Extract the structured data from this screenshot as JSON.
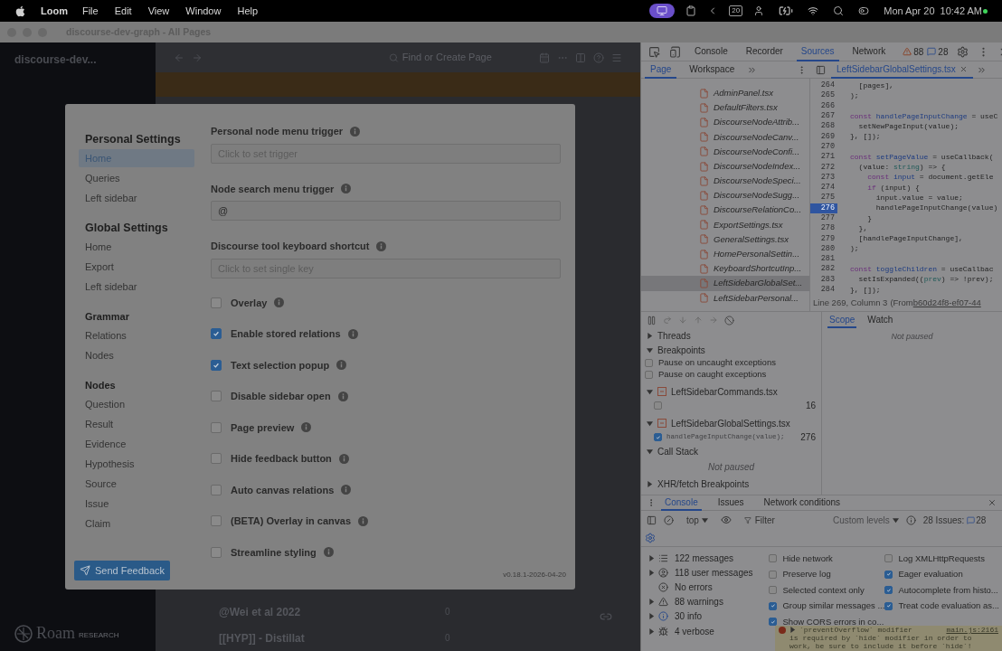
{
  "menubar": {
    "app": "Loom",
    "menus": [
      "File",
      "Edit",
      "View",
      "Window",
      "Help"
    ],
    "calendar_day": "20",
    "date": "Mon Apr 20",
    "time": "10:42 AM"
  },
  "window": {
    "title": "discourse-dev-graph - All Pages"
  },
  "roam": {
    "graph_name": "discourse-dev...",
    "search": {
      "placeholder": "Find or Create Page"
    },
    "rows": [
      {
        "title": "@Wei et al 2022",
        "count": "0"
      },
      {
        "title": "[[HYP]] - Distillat",
        "count": "0"
      }
    ],
    "logo": {
      "word": "Roam",
      "tag": "RESEARCH"
    }
  },
  "settings_dialog": {
    "nav": [
      {
        "heading": "Personal Settings",
        "kind": "major",
        "items": [
          {
            "label": "Home",
            "selected": true
          },
          {
            "label": "Queries",
            "selected": false
          },
          {
            "label": "Left sidebar",
            "selected": false
          }
        ]
      },
      {
        "heading": "Global Settings",
        "kind": "major",
        "items": [
          {
            "label": "Home",
            "selected": false
          },
          {
            "label": "Export",
            "selected": false
          },
          {
            "label": "Left sidebar",
            "selected": false
          }
        ]
      },
      {
        "heading": "Grammar",
        "kind": "minor",
        "items": [
          {
            "label": "Relations",
            "selected": false
          },
          {
            "label": "Nodes",
            "selected": false
          }
        ]
      },
      {
        "heading": "Nodes",
        "kind": "minor",
        "items": [
          {
            "label": "Question",
            "selected": false
          },
          {
            "label": "Result",
            "selected": false
          },
          {
            "label": "Evidence",
            "selected": false
          },
          {
            "label": "Hypothesis",
            "selected": false
          },
          {
            "label": "Source",
            "selected": false
          },
          {
            "label": "Issue",
            "selected": false
          },
          {
            "label": "Claim",
            "selected": false
          }
        ]
      }
    ],
    "fields": [
      {
        "label": "Personal node menu trigger",
        "placeholder": "Click to set trigger"
      },
      {
        "label": "Node search menu trigger",
        "value": "@"
      },
      {
        "label": "Discourse tool keyboard shortcut",
        "placeholder": "Click to set single key"
      }
    ],
    "toggles": [
      {
        "label": "Overlay",
        "checked": false
      },
      {
        "label": "Enable stored relations",
        "checked": true
      },
      {
        "label": "Text selection popup",
        "checked": true
      },
      {
        "label": "Disable sidebar open",
        "checked": false
      },
      {
        "label": "Page preview",
        "checked": false
      },
      {
        "label": "Hide feedback button",
        "checked": false
      },
      {
        "label": "Auto canvas relations",
        "checked": false
      },
      {
        "label": "(BETA) Overlay in canvas",
        "checked": false
      },
      {
        "label": "Streamline styling",
        "checked": false
      }
    ],
    "feedback_button": "Send Feedback",
    "version": "v0.18.1-2026-04-20"
  },
  "devtools": {
    "tabs": [
      {
        "label": "Console",
        "selected": false
      },
      {
        "label": "Recorder",
        "selected": false
      },
      {
        "label": "Sources",
        "selected": true
      },
      {
        "label": "Network",
        "selected": false
      }
    ],
    "warnings": "88",
    "issues": "28",
    "nav_tabs": [
      {
        "label": "Page",
        "selected": true
      },
      {
        "label": "Workspace",
        "selected": false
      }
    ],
    "editor_tab": "LeftSidebarGlobalSettings.tsx",
    "files": [
      {
        "name": "AdminPanel.tsx",
        "selected": false
      },
      {
        "name": "DefaultFilters.tsx",
        "selected": false
      },
      {
        "name": "DiscourseNodeAttrib...",
        "selected": false
      },
      {
        "name": "DiscourseNodeCanv...",
        "selected": false
      },
      {
        "name": "DiscourseNodeConfi...",
        "selected": false
      },
      {
        "name": "DiscourseNodeIndex...",
        "selected": false
      },
      {
        "name": "DiscourseNodeSpeci...",
        "selected": false
      },
      {
        "name": "DiscourseNodeSugg...",
        "selected": false
      },
      {
        "name": "DiscourseRelationCo...",
        "selected": false
      },
      {
        "name": "ExportSettings.tsx",
        "selected": false
      },
      {
        "name": "GeneralSettings.tsx",
        "selected": false
      },
      {
        "name": "HomePersonalSettin...",
        "selected": false
      },
      {
        "name": "KeyboardShortcutInp...",
        "selected": false
      },
      {
        "name": "LeftSidebarGlobalSet...",
        "selected": true
      },
      {
        "name": "LeftSidebarPersonal...",
        "selected": false
      }
    ],
    "code": [
      {
        "number": "264",
        "breakpoint": false,
        "tokens": [
          {
            "kind": "plain",
            "text": "  [pages],"
          }
        ]
      },
      {
        "number": "265",
        "breakpoint": false,
        "tokens": [
          {
            "kind": "plain",
            "text": ");"
          }
        ]
      },
      {
        "number": "266",
        "breakpoint": false
      },
      {
        "number": "267",
        "breakpoint": false,
        "tokens": [
          {
            "kind": "keyword",
            "text": "const "
          },
          {
            "kind": "name",
            "text": "handlePageInputChange"
          },
          {
            "kind": "plain",
            "text": " = useC"
          }
        ]
      },
      {
        "number": "268",
        "breakpoint": false,
        "tokens": [
          {
            "kind": "plain",
            "text": "  setNewPageInput(value);"
          }
        ]
      },
      {
        "number": "269",
        "breakpoint": false,
        "tokens": [
          {
            "kind": "plain",
            "text": "}, []);"
          }
        ]
      },
      {
        "number": "270",
        "breakpoint": false
      },
      {
        "number": "271",
        "breakpoint": false,
        "tokens": [
          {
            "kind": "keyword",
            "text": "const "
          },
          {
            "kind": "name",
            "text": "setPageValue"
          },
          {
            "kind": "plain",
            "text": " = useCallback("
          }
        ]
      },
      {
        "number": "272",
        "breakpoint": false,
        "tokens": [
          {
            "kind": "plain",
            "text": "  (value: "
          },
          {
            "kind": "type",
            "text": "string"
          },
          {
            "kind": "plain",
            "text": ") => {"
          }
        ]
      },
      {
        "number": "273",
        "breakpoint": false,
        "tokens": [
          {
            "kind": "keyword",
            "text": "    const "
          },
          {
            "kind": "name",
            "text": "input"
          },
          {
            "kind": "plain",
            "text": " = document.getEle"
          }
        ]
      },
      {
        "number": "274",
        "breakpoint": false,
        "tokens": [
          {
            "kind": "keyword",
            "text": "    if "
          },
          {
            "kind": "plain",
            "text": "(input) {"
          }
        ]
      },
      {
        "number": "275",
        "breakpoint": false,
        "tokens": [
          {
            "kind": "plain",
            "text": "      input.value = value;"
          }
        ]
      },
      {
        "number": "276",
        "breakpoint": true,
        "tokens": [
          {
            "kind": "plain",
            "text": "      handlePageInputChange(value)"
          }
        ]
      },
      {
        "number": "277",
        "breakpoint": false,
        "tokens": [
          {
            "kind": "plain",
            "text": "    }"
          }
        ]
      },
      {
        "number": "278",
        "breakpoint": false,
        "tokens": [
          {
            "kind": "plain",
            "text": "  },"
          }
        ]
      },
      {
        "number": "279",
        "breakpoint": false,
        "tokens": [
          {
            "kind": "plain",
            "text": "  [handlePageInputChange],"
          }
        ]
      },
      {
        "number": "280",
        "breakpoint": false,
        "tokens": [
          {
            "kind": "plain",
            "text": ");"
          }
        ]
      },
      {
        "number": "281",
        "breakpoint": false
      },
      {
        "number": "282",
        "breakpoint": false,
        "tokens": [
          {
            "kind": "keyword",
            "text": "const "
          },
          {
            "kind": "name",
            "text": "toggleChildren"
          },
          {
            "kind": "plain",
            "text": " = useCallbac"
          }
        ]
      },
      {
        "number": "283",
        "breakpoint": false,
        "tokens": [
          {
            "kind": "plain",
            "text": "  setIsExpanded(("
          },
          {
            "kind": "type",
            "text": "prev"
          },
          {
            "kind": "plain",
            "text": ") => !prev);"
          }
        ]
      },
      {
        "number": "284",
        "breakpoint": false,
        "tokens": [
          {
            "kind": "plain",
            "text": "}, []);"
          }
        ]
      }
    ],
    "status": {
      "position": "Line 269, Column 3",
      "source_prefix": "(From ",
      "source_link": "b60d24f8-ef07-44"
    },
    "sections": [
      {
        "kind": "threads",
        "title": "Threads",
        "expanded": false
      },
      {
        "kind": "breakpoints",
        "title": "Breakpoints",
        "expanded": true
      },
      {
        "kind": "callstack",
        "title": "Call Stack",
        "expanded": true
      },
      {
        "kind": "xhr",
        "title": "XHR/fetch Breakpoints",
        "expanded": false
      }
    ],
    "pause_options": [
      {
        "label": "Pause on uncaught exceptions",
        "checked": false
      },
      {
        "label": "Pause on caught exceptions",
        "checked": false
      }
    ],
    "breakpoint_files": [
      {
        "file": "LeftSidebarCommands.tsx",
        "expanded": true,
        "entries": [
          {
            "checked": false,
            "line": "16"
          }
        ]
      },
      {
        "file": "LeftSidebarGlobalSettings.tsx",
        "expanded": true,
        "entries": [
          {
            "checked": true,
            "code": "handlePageInputChange(value);",
            "line": "276"
          }
        ]
      }
    ],
    "callstack_message": "Not paused",
    "scope_tabs": [
      {
        "label": "Scope",
        "selected": true
      },
      {
        "label": "Watch",
        "selected": false
      }
    ],
    "scope_message": "Not paused",
    "drawer": {
      "tabs": [
        {
          "label": "Console",
          "selected": true
        },
        {
          "label": "Issues",
          "selected": false
        },
        {
          "label": "Network conditions",
          "selected": false
        }
      ],
      "context": "top",
      "filter": {
        "placeholder": "Filter"
      },
      "levels": "Custom levels",
      "issues_label": "28 Issues:",
      "issues_count": "28",
      "message_groups": [
        {
          "kind": "all",
          "label": "122 messages",
          "expandable": true
        },
        {
          "kind": "user",
          "label": "118 user messages",
          "expandable": true
        },
        {
          "kind": "error",
          "label": "No errors",
          "expandable": false
        },
        {
          "kind": "warning",
          "label": "88 warnings",
          "expandable": true
        },
        {
          "kind": "info",
          "label": "30 info",
          "expandable": true
        },
        {
          "kind": "verbose",
          "label": "4 verbose",
          "expandable": true
        }
      ],
      "settings_left": [
        {
          "label": "Hide network",
          "checked": false
        },
        {
          "label": "Preserve log",
          "checked": false
        },
        {
          "label": "Selected context only",
          "checked": false
        },
        {
          "label": "Group similar messages ...",
          "checked": true
        },
        {
          "label": "Show CORS errors in co...",
          "checked": true
        }
      ],
      "settings_right": [
        {
          "label": "Log XMLHttpRequests",
          "checked": false
        },
        {
          "label": "Eager evaluation",
          "checked": true
        },
        {
          "label": "Autocomplete from histo...",
          "checked": true
        },
        {
          "label": "Treat code evaluation as...",
          "checked": true
        }
      ],
      "warning": {
        "head": "`preventOverflow` modifier",
        "source": "main.js:2161",
        "lines": [
          "is required by `hide` modifier in order to",
          "work, be sure to include it before `hide`!"
        ]
      }
    }
  }
}
